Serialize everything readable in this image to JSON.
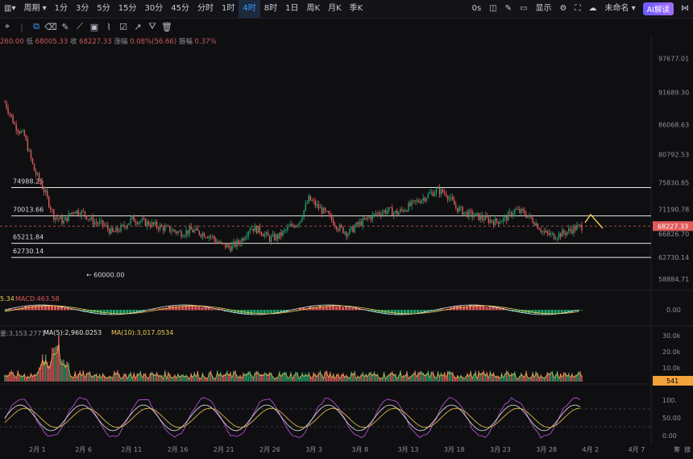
{
  "topbar": {
    "period_label": "周期",
    "intervals": [
      "1分",
      "3分",
      "5分",
      "15分",
      "30分",
      "45分",
      "分时",
      "1时",
      "4时",
      "8时",
      "1日",
      "周K",
      "月K",
      "季K"
    ],
    "active_interval": "4时",
    "countdown": "0s",
    "display_label": "显示",
    "unnamed_label": "未命名",
    "ai_label": "AI解读"
  },
  "ohlc": {
    "open_partial": "260.00",
    "low_label": "低",
    "low": "68005.33",
    "close_label": "收",
    "close": "68227.33",
    "change_label": "涨幅",
    "change": "0.08%(56.66)",
    "amp_label": "振幅",
    "amp": "0.37%"
  },
  "indicators": {
    "macd_partial": "5.34",
    "macd_label": "MACD:463.58",
    "vol_partial": "量:3,153.2771",
    "ma5_label": "MA(5):2,960.0253",
    "ma10_label": "MA(10):3,017.0534"
  },
  "colors": {
    "up": "#22a06b",
    "down": "#e05a5a",
    "ma5": "#f2c94c",
    "k": "#e7e7e7",
    "j": "#b04fd1",
    "accent": "#3b9cff"
  },
  "chart_data": {
    "type": "candlestick",
    "price_axis_ticks": [
      97677.01,
      91689.3,
      86068.63,
      80792.53,
      75830.85,
      71190.78,
      66826.7,
      62730.14,
      58884.71
    ],
    "current_price": "68227.33",
    "levels": [
      {
        "label": "74988.25",
        "value": 74988.25
      },
      {
        "label": "70013.66",
        "value": 70013.66
      },
      {
        "label": "65211.84",
        "value": 65211.84
      },
      {
        "label": "62730.14",
        "value": 62730.14
      }
    ],
    "low_annotation": "← 60000.00",
    "x_tick_labels": [
      "2月 1",
      "2月 6",
      "2月 11",
      "2月 16",
      "2月 21",
      "2月 26",
      "3月 3",
      "3月 8",
      "3月 13",
      "3月 18",
      "3月 23",
      "3月 28",
      "4月 2",
      "4月 7"
    ],
    "price_path": [
      [
        "2月 1",
        90000
      ],
      [
        "2月 2",
        86000
      ],
      [
        "2月 3",
        84000
      ],
      [
        "2月 4",
        78000
      ],
      [
        "2月 5",
        74500
      ],
      [
        "2月 6",
        70000
      ],
      [
        "2月 7",
        69000
      ],
      [
        "2月 8",
        71000
      ],
      [
        "2月 9",
        70500
      ],
      [
        "2月 10",
        69000
      ],
      [
        "2月 11",
        68500
      ],
      [
        "2月 12",
        67000
      ],
      [
        "2月 13",
        68000
      ],
      [
        "2月 14",
        69500
      ],
      [
        "2月 15",
        69000
      ],
      [
        "2月 16",
        68500
      ],
      [
        "2月 17",
        68000
      ],
      [
        "2月 18",
        67500
      ],
      [
        "2月 19",
        67000
      ],
      [
        "2月 20",
        67500
      ],
      [
        "2月 21",
        67000
      ],
      [
        "2月 22",
        66500
      ],
      [
        "2月 23",
        65000
      ],
      [
        "2月 24",
        64500
      ],
      [
        "2月 25",
        65500
      ],
      [
        "2月 26",
        68000
      ],
      [
        "2月 27",
        67500
      ],
      [
        "2月 28",
        66000
      ],
      [
        "3月 1",
        66500
      ],
      [
        "3月 2",
        68000
      ],
      [
        "3月 3",
        69000
      ],
      [
        "3月 4",
        73000
      ],
      [
        "3月 5",
        71500
      ],
      [
        "3月 6",
        70000
      ],
      [
        "3月 7",
        68000
      ],
      [
        "3月 8",
        67000
      ],
      [
        "3月 9",
        68500
      ],
      [
        "3月 10",
        69500
      ],
      [
        "3月 11",
        70500
      ],
      [
        "3月 12",
        71000
      ],
      [
        "3月 13",
        70500
      ],
      [
        "3月 14",
        71500
      ],
      [
        "3月 15",
        72500
      ],
      [
        "3月 16",
        73500
      ],
      [
        "3月 17",
        74500
      ],
      [
        "3月 18",
        74000
      ],
      [
        "3月 19",
        71500
      ],
      [
        "3月 20",
        70500
      ],
      [
        "3月 21",
        70000
      ],
      [
        "3月 22",
        69500
      ],
      [
        "3月 23",
        69000
      ],
      [
        "3月 24",
        69500
      ],
      [
        "3月 25",
        71000
      ],
      [
        "3月 26",
        70500
      ],
      [
        "3月 27",
        69000
      ],
      [
        "3月 28",
        67000
      ],
      [
        "3月 29",
        66500
      ],
      [
        "3月 30",
        67000
      ],
      [
        "3月 31",
        67800
      ],
      [
        "4月 1",
        68227.33
      ]
    ],
    "ylim": [
      57500,
      100000
    ],
    "macd_axis": [
      "0.00"
    ],
    "volume_axis": [
      "30.0k",
      "20.0k",
      "10.0k"
    ],
    "volume_current": "541",
    "kdj_axis": [
      "100.",
      "50.00",
      "0.00"
    ],
    "corner_labels": [
      "筹",
      "搜"
    ]
  }
}
